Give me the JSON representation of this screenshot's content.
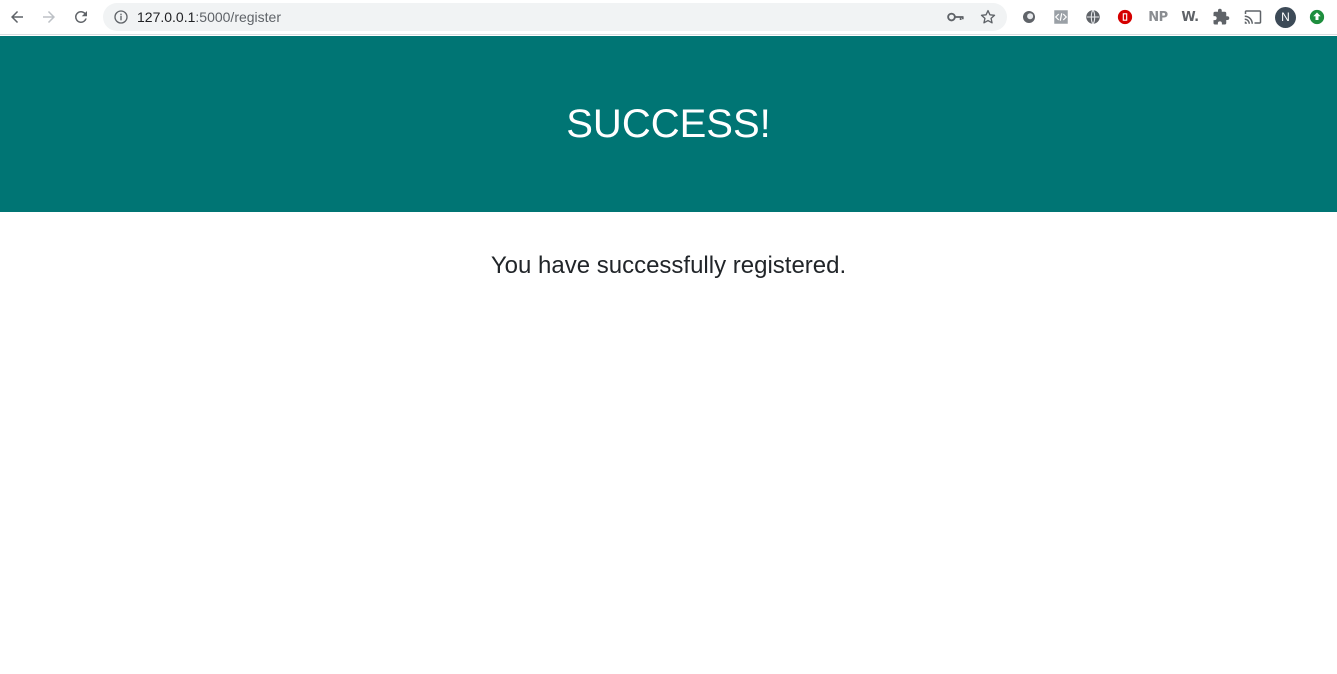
{
  "browser": {
    "url_host": "127.0.0.1",
    "url_path": ":5000/register",
    "avatar_initial": "N",
    "extension_np_label": "NP",
    "extension_w_label": "W.",
    "icons": [
      "back-arrow-icon",
      "forward-arrow-icon",
      "reload-icon",
      "info-icon",
      "key-icon",
      "star-icon",
      "extension-circle-icon",
      "extension-code-icon",
      "extension-globe-icon",
      "extension-stop-icon",
      "puzzle-icon",
      "cast-icon",
      "update-icon"
    ]
  },
  "hero": {
    "title": "SUCCESS!",
    "background_color": "#007574"
  },
  "main": {
    "message": "You have successfully registered."
  }
}
